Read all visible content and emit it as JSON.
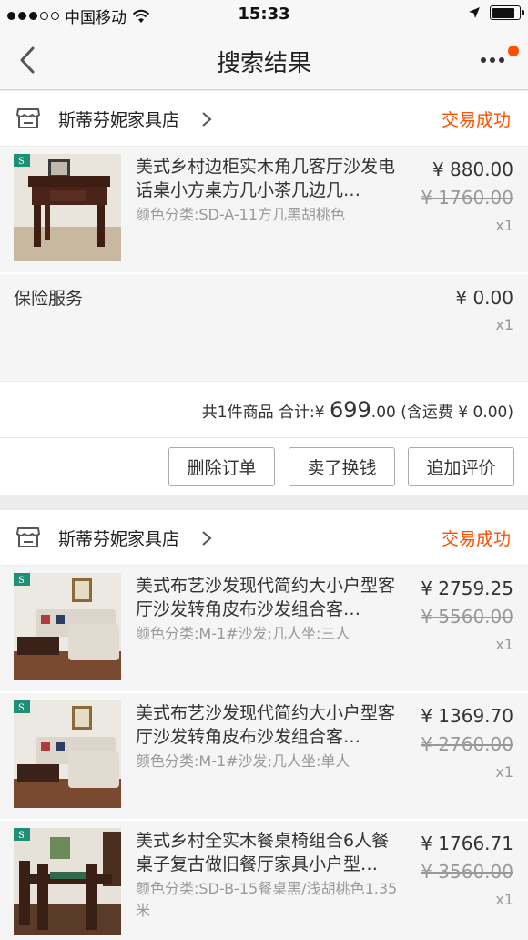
{
  "status_bar": {
    "carrier": "中国移动",
    "time": "15:33"
  },
  "nav": {
    "title": "搜索结果"
  },
  "orders": [
    {
      "shop_name": "斯蒂芬妮家具店",
      "status": "交易成功",
      "items": [
        {
          "name": "美式乡村边柜实木角几客厅沙发电话桌小方桌方几小茶几边几…",
          "sku": "颜色分类:SD-A-11方几黑胡桃色",
          "price": "¥ 880.00",
          "original_price": "¥ 1760.00",
          "qty": "x1"
        }
      ],
      "insurance": {
        "label": "保险服务",
        "price": "¥ 0.00",
        "qty": "x1"
      },
      "summary": {
        "prefix": "共1件商品  合计:",
        "currency": "¥",
        "total_int": "699",
        "total_dec": ".00",
        "shipping": "(含运费 ¥ 0.00)"
      },
      "actions": [
        "删除订单",
        "卖了换钱",
        "追加评价"
      ]
    },
    {
      "shop_name": "斯蒂芬妮家具店",
      "status": "交易成功",
      "items": [
        {
          "name": "美式布艺沙发现代简约大小户型客厅沙发转角皮布沙发组合客…",
          "sku": "颜色分类:M-1#沙发;几人坐:三人",
          "price": "¥ 2759.25",
          "original_price": "¥ 5560.00",
          "qty": "x1"
        },
        {
          "name": "美式布艺沙发现代简约大小户型客厅沙发转角皮布沙发组合客…",
          "sku": "颜色分类:M-1#沙发;几人坐:单人",
          "price": "¥ 1369.70",
          "original_price": "¥ 2760.00",
          "qty": "x1"
        },
        {
          "name": "美式乡村全实木餐桌椅组合6人餐桌子复古做旧餐厅家具小户型…",
          "sku": "颜色分类:SD-B-15餐桌黑/浅胡桃色1.35米",
          "price": "¥ 1766.71",
          "original_price": "¥ 3560.00",
          "qty": "x1"
        }
      ]
    }
  ]
}
